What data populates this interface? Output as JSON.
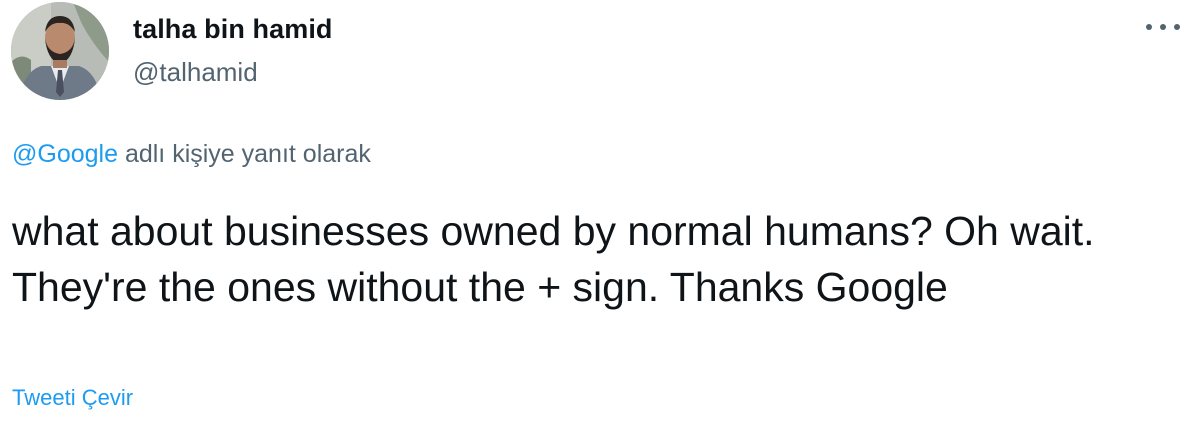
{
  "user": {
    "display_name": "talha bin hamid",
    "handle": "@talhamid",
    "avatar_icon": "profile-photo"
  },
  "reply_context": {
    "mention": "@Google",
    "text": " adlı kişiye yanıt olarak"
  },
  "tweet": {
    "text": "what about businesses owned by normal humans? Oh wait. They're the ones without the + sign. Thanks Google"
  },
  "actions": {
    "more_icon": "more-horizontal-icon",
    "translate_label": "Tweeti Çevir"
  },
  "colors": {
    "link": "#1d9bf0",
    "secondary_text": "#536471",
    "primary_text": "#0f1419",
    "background": "#ffffff"
  }
}
